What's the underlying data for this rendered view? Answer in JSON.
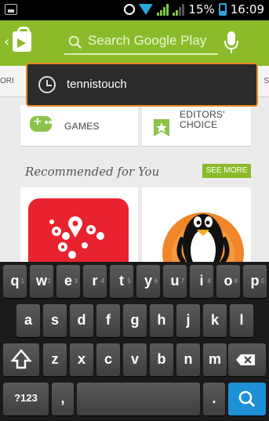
{
  "status_bar": {
    "battery_percent": "15%",
    "time": "16:09",
    "icons": [
      "screenshot-icon",
      "alarm-icon",
      "wifi-icon",
      "signal-icon",
      "signal-icon-2",
      "battery-icon"
    ]
  },
  "app_bar": {
    "search_placeholder": "Search Google Play",
    "icons": [
      "back-chevron-icon",
      "play-store-icon",
      "search-icon",
      "microphone-icon"
    ]
  },
  "tabs_fragments": {
    "left": "ORI",
    "right": "S"
  },
  "cards": {
    "games_label": "GAMES",
    "editors_label_1": "EDITORS'",
    "editors_label_2": "CHOICE"
  },
  "recommended": {
    "title": "Recommended for You",
    "see_more": "SEE MORE"
  },
  "suggestion": {
    "text": "tennistouch"
  },
  "keyboard": {
    "row1": [
      {
        "k": "q",
        "h": "1"
      },
      {
        "k": "w",
        "h": "2"
      },
      {
        "k": "e",
        "h": "3"
      },
      {
        "k": "r",
        "h": "4"
      },
      {
        "k": "t",
        "h": "5"
      },
      {
        "k": "y",
        "h": "6"
      },
      {
        "k": "u",
        "h": "7"
      },
      {
        "k": "i",
        "h": "8"
      },
      {
        "k": "o",
        "h": "9"
      },
      {
        "k": "p",
        "h": "0"
      }
    ],
    "row2": [
      "a",
      "s",
      "d",
      "f",
      "g",
      "h",
      "j",
      "k",
      "l"
    ],
    "row3": [
      "z",
      "x",
      "c",
      "v",
      "b",
      "n",
      "m"
    ],
    "sym_label": "?123",
    "comma": ",",
    "period": "."
  },
  "colors": {
    "brand_green": "#8bbb2a",
    "suggestion_border": "#e8892b",
    "search_key_blue": "#1e90d6"
  }
}
